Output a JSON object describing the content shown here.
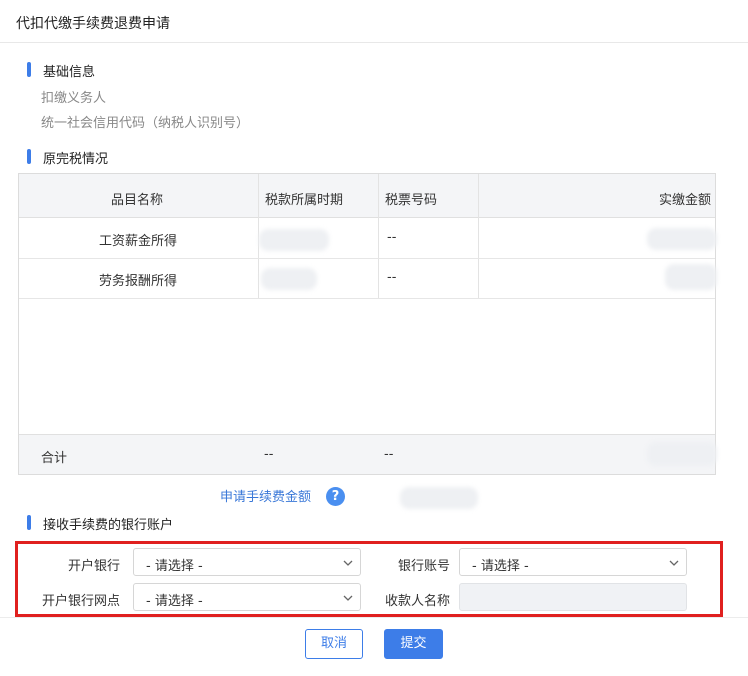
{
  "window": {
    "title": "代扣代缴手续费退费申请"
  },
  "basic_info": {
    "heading": "基础信息",
    "withholding_agent_label": "扣缴义务人",
    "credit_code_label": "统一社会信用代码（纳税人识别号）"
  },
  "tax_status": {
    "heading": "原完税情况",
    "columns": [
      "品目名称",
      "税款所属时期",
      "税票号码",
      "实缴金额"
    ],
    "rows": [
      {
        "item": "工资薪金所得",
        "period": "",
        "ticket": "--",
        "amount": ""
      },
      {
        "item": "劳务报酬所得",
        "period": "",
        "ticket": "--",
        "amount": ""
      }
    ],
    "total": {
      "label": "合计",
      "period": "--",
      "ticket": "--",
      "amount": ""
    }
  },
  "fee": {
    "link_label": "申请手续费金额",
    "help_icon": "question-circle-icon",
    "help_glyph": "?"
  },
  "bank_account": {
    "heading": "接收手续费的银行账户",
    "bank_label": "开户银行",
    "bank_value": "- 请选择 -",
    "account_label": "银行账号",
    "account_value": "- 请选择 -",
    "branch_label": "开户银行网点",
    "branch_value": "- 请选择 -",
    "payee_label": "收款人名称",
    "payee_value": ""
  },
  "actions": {
    "cancel": "取消",
    "submit": "提交"
  },
  "colors": {
    "accent": "#3d7de8",
    "highlight_box": "#e0201f",
    "header_bg": "#f4f5f7"
  }
}
